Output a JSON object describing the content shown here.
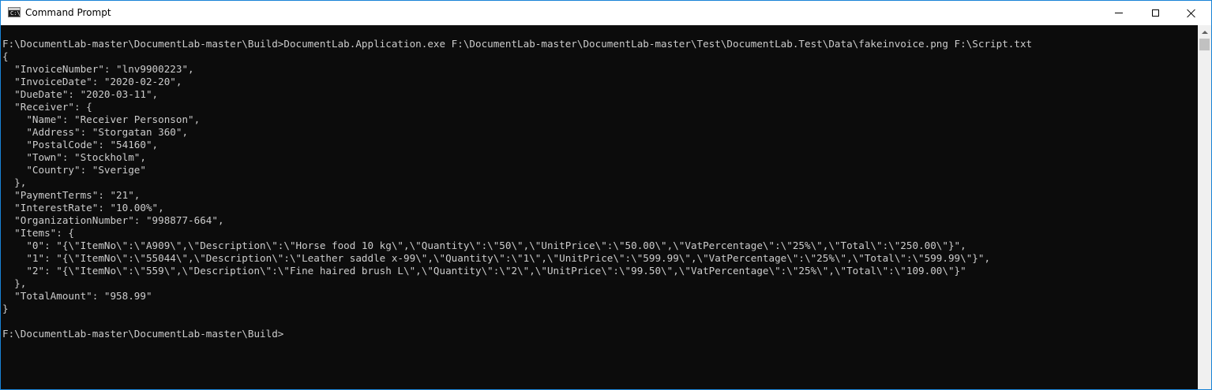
{
  "window": {
    "title": "Command Prompt",
    "icon": "console-icon",
    "icon_text": "C:\\_"
  },
  "console": {
    "lines": [
      "F:\\DocumentLab-master\\DocumentLab-master\\Build>DocumentLab.Application.exe F:\\DocumentLab-master\\DocumentLab-master\\Test\\DocumentLab.Test\\Data\\fakeinvoice.png F:\\Script.txt",
      "{",
      "  \"InvoiceNumber\": \"lnv9900223\",",
      "  \"InvoiceDate\": \"2020-02-20\",",
      "  \"DueDate\": \"2020-03-11\",",
      "  \"Receiver\": {",
      "    \"Name\": \"Receiver Personson\",",
      "    \"Address\": \"Storgatan 360\",",
      "    \"PostalCode\": \"54160\",",
      "    \"Town\": \"Stockholm\",",
      "    \"Country\": \"Sverige\"",
      "  },",
      "  \"PaymentTerms\": \"21\",",
      "  \"InterestRate\": \"10.00%\",",
      "  \"OrganizationNumber\": \"998877-664\",",
      "  \"Items\": {",
      "    \"0\": \"{\\\"ItemNo\\\":\\\"A909\\\",\\\"Description\\\":\\\"Horse food 10 kg\\\",\\\"Quantity\\\":\\\"50\\\",\\\"UnitPrice\\\":\\\"50.00\\\",\\\"VatPercentage\\\":\\\"25%\\\",\\\"Total\\\":\\\"250.00\\\"}\",",
      "    \"1\": \"{\\\"ItemNo\\\":\\\"55044\\\",\\\"Description\\\":\\\"Leather saddle x-99\\\",\\\"Quantity\\\":\\\"1\\\",\\\"UnitPrice\\\":\\\"599.99\\\",\\\"VatPercentage\\\":\\\"25%\\\",\\\"Total\\\":\\\"599.99\\\"}\",",
      "    \"2\": \"{\\\"ItemNo\\\":\\\"559\\\",\\\"Description\\\":\\\"Fine haired brush L\\\",\\\"Quantity\\\":\\\"2\\\",\\\"UnitPrice\\\":\\\"99.50\\\",\\\"VatPercentage\\\":\\\"25%\\\",\\\"Total\\\":\\\"109.00\\\"}\"",
      "  },",
      "  \"TotalAmount\": \"958.99\"",
      "}",
      "",
      "F:\\DocumentLab-master\\DocumentLab-master\\Build>"
    ]
  },
  "scrollbar": {
    "up_icon": "chevron-up-icon"
  },
  "colors": {
    "console_bg": "#0c0c0c",
    "console_fg": "#cccccc",
    "titlebar_bg": "#ffffff",
    "border_accent": "#1883d7"
  }
}
